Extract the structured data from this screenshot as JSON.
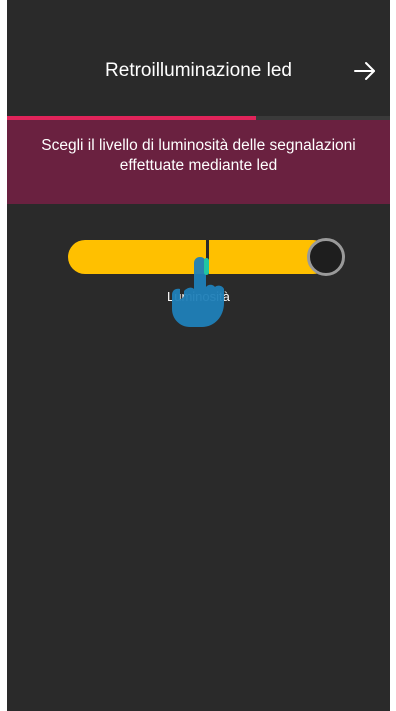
{
  "header": {
    "title": "Retroilluminazione led",
    "next_icon": "arrow-right-icon"
  },
  "progress": {
    "fraction": 0.65,
    "color": "#e0245a"
  },
  "banner": {
    "text": "Scegli il livello di luminosità delle segnalazioni effettuate mediante led",
    "background": "#6a2140"
  },
  "slider": {
    "label": "Luminosità",
    "level": 1.0,
    "track_color": "#ffc000"
  },
  "overlay": {
    "icon": "tap-hand-icon"
  }
}
